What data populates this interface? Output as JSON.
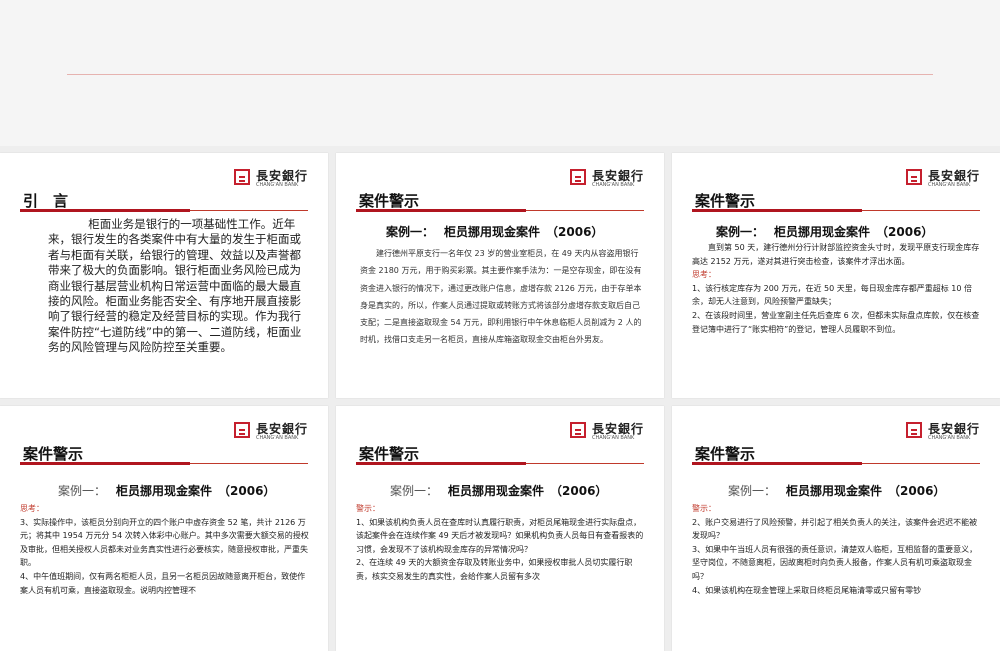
{
  "bank": {
    "cn": "長安銀行",
    "en": "CHANG'AN BANK"
  },
  "slide1": {
    "title": "引　言",
    "body": "柜面业务是银行的一项基础性工作。近年来，银行发生的各类案件中有大量的发生于柜面或者与柜面有关联，给银行的管理、效益以及声誉都带来了极大的负面影响。银行柜面业务风险已成为商业银行基层营业机构日常运营中面临的最大最直接的风险。柜面业务能否安全、有序地开展直接影响了银行经营的稳定及经营目标的实现。作为我行案件防控“七道防线”中的第一、二道防线，柜面业务的风险管理与风险防控至关重要。"
  },
  "slide2": {
    "title": "案件警示",
    "case_no": "案例一：",
    "case_name": "柜员挪用现金案件　（2006）",
    "body": "建行德州平原支行一名年仅 23 岁的营业室柜员，在 49 天内从容盗用银行资金 2180 万元，用于购买彩票。其主要作案手法为：一是空存现金，即在没有资金进入银行的情况下，通过更改账户信息，虚增存款 2126 万元，由于存单本身是真实的，所以，作案人员通过提取或转账方式将该部分虚增存款支取后自己支配；二是直接盗取现金 54 万元，即利用银行中午休息临柜人员削减为 2 人的时机，找借口支走另一名柜员，直接从库箱盗取现金交由柜台外男友。"
  },
  "slide3": {
    "title": "案件警示",
    "case_no": "案例一：",
    "case_name": "柜员挪用现金案件　（2006）",
    "intro": "直到第 50 天，建行德州分行计财部监控资金头寸时，发现平原支行现金库存高达 2152 万元，遂对其进行突击检查，该案件才浮出水面。",
    "label": "思考：",
    "items": [
      "1、该行核定库存为 200 万元，在近 50 天里，每日现金库存都严重超标 10 倍余，却无人注意到，风险预警严重缺失；",
      "2、在该段时间里，营业室副主任先后查库 6 次，但都未实际盘点库款，仅在核查登记簿中进行了“账实相符”的登记，管理人员履职不到位。"
    ]
  },
  "slide4": {
    "title": "案件警示",
    "case_no": "案例一：",
    "case_name": "柜员挪用现金案件　（2006）",
    "label": "思考：",
    "items": [
      "3、实际操作中，该柜员分别向开立的四个账户中虚存资金 52 笔，共计 2126 万元；将其中 1954 万元分 54 次转入体彩中心账户。其中多次需要大额交易的授权及审批，但相关授权人员都未对业务真实性进行必要核实，随意授权审批，严重失职。",
      "4、中午值班期间，仅有两名柜柜人员，且另一名柜员因故随意离开柜台，致使作案人员有机可乘，直接盗取现金。说明内控管理不"
    ]
  },
  "slide5": {
    "title": "案件警示",
    "case_no": "案例一：",
    "case_name": "柜员挪用现金案件　（2006）",
    "label": "警示：",
    "items": [
      "1、如果该机构负责人员在查库时认真履行职责，对柜员尾箱现金进行实际盘点，该起案件会在连续作案 49 天后才被发现吗？如果机构负责人员每日有查看报表的习惯，会发现不了该机构现金库存的异常情况吗？",
      "2、在连续 49 天的大额资金存取及转账业务中，如果授权审批人员切实履行职责，核实交易发生的真实性，会给作案人员留有多次"
    ]
  },
  "slide6": {
    "title": "案件警示",
    "case_no": "案例一：",
    "case_name": "柜员挪用现金案件　（2006）",
    "label": "警示：",
    "items": [
      "2、账户交易进行了风险预警，并引起了相关负责人的关注，该案件会迟迟不能被发现吗？",
      "3、如果中午当班人员有很强的责任意识，清楚双人临柜，互相监督的重要意义，坚守岗位，不随意离柜，因故离柜时向负责人报备，作案人员有机可乘盗取现金吗？",
      "4、如果该机构在现金管理上采取日终柜员尾箱清零或只留有零钞"
    ]
  }
}
